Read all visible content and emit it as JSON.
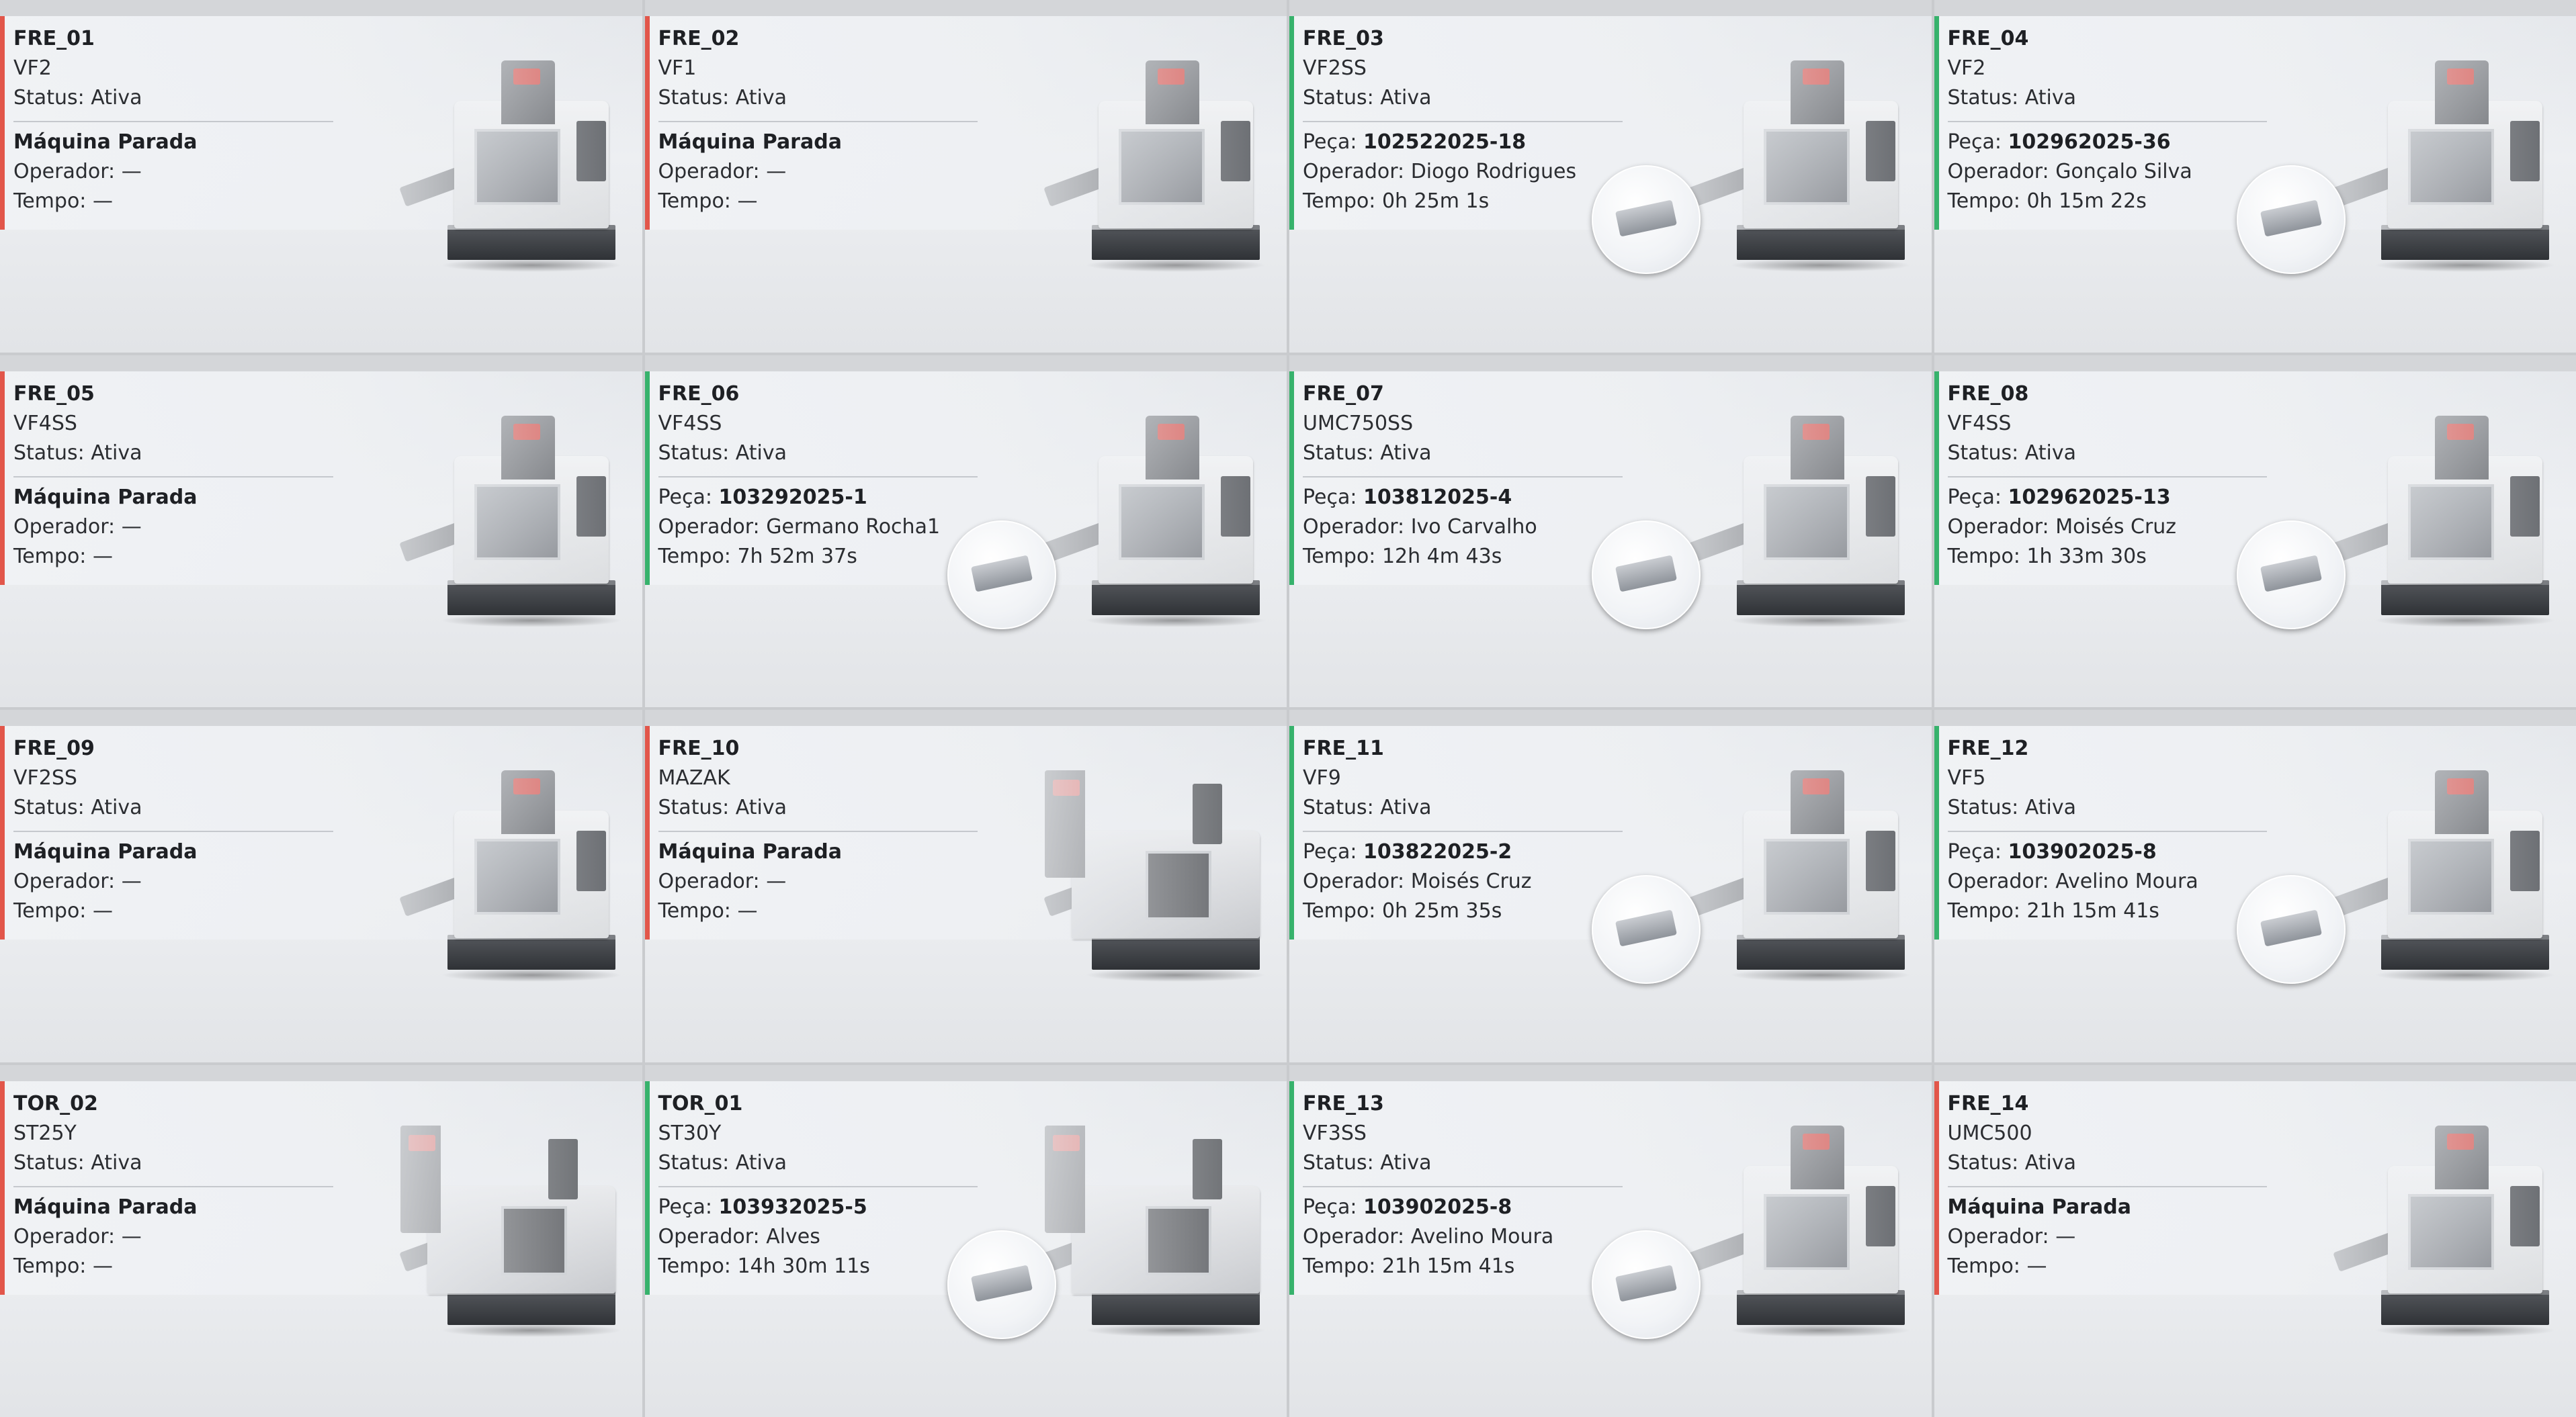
{
  "labels": {
    "status_prefix": "Status: ",
    "part_prefix": "Peça: ",
    "operator_prefix": "Operador: ",
    "time_prefix": "Tempo: ",
    "stopped": "Máquina Parada",
    "none": "—"
  },
  "colors": {
    "stopped_accent": "#e2564a",
    "running_accent": "#37b26c"
  },
  "machines": [
    {
      "code": "FRE_01",
      "model": "VF2",
      "status": "Ativa",
      "state": "stopped",
      "illustration": "vertical-mill",
      "part": null,
      "operator": "—",
      "time": "—"
    },
    {
      "code": "FRE_02",
      "model": "VF1",
      "status": "Ativa",
      "state": "stopped",
      "illustration": "vertical-mill",
      "part": null,
      "operator": "—",
      "time": "—"
    },
    {
      "code": "FRE_03",
      "model": "VF2SS",
      "status": "Ativa",
      "state": "running",
      "illustration": "vertical-mill",
      "part": "102522025-18",
      "operator": "Diogo Rodrigues",
      "time": "0h 25m 1s"
    },
    {
      "code": "FRE_04",
      "model": "VF2",
      "status": "Ativa",
      "state": "running",
      "illustration": "vertical-mill",
      "part": "102962025-36",
      "operator": "Gonçalo Silva",
      "time": "0h 15m 22s"
    },
    {
      "code": "FRE_05",
      "model": "VF4SS",
      "status": "Ativa",
      "state": "stopped",
      "illustration": "vertical-mill",
      "part": null,
      "operator": "—",
      "time": "—"
    },
    {
      "code": "FRE_06",
      "model": "VF4SS",
      "status": "Ativa",
      "state": "running",
      "illustration": "vertical-mill",
      "part": "103292025-1",
      "operator": "Germano Rocha1",
      "time": "7h 52m 37s"
    },
    {
      "code": "FRE_07",
      "model": "UMC750SS",
      "status": "Ativa",
      "state": "running",
      "illustration": "universal-mill",
      "part": "103812025-4",
      "operator": "Ivo Carvalho",
      "time": "12h 4m 43s"
    },
    {
      "code": "FRE_08",
      "model": "VF4SS",
      "status": "Ativa",
      "state": "running",
      "illustration": "vertical-mill",
      "part": "102962025-13",
      "operator": "Moisés Cruz",
      "time": "1h 33m 30s"
    },
    {
      "code": "FRE_09",
      "model": "VF2SS",
      "status": "Ativa",
      "state": "stopped",
      "illustration": "vertical-mill",
      "part": null,
      "operator": "—",
      "time": "—"
    },
    {
      "code": "FRE_10",
      "model": "MAZAK",
      "status": "Ativa",
      "state": "stopped",
      "illustration": "lathe",
      "part": null,
      "operator": "—",
      "time": "—"
    },
    {
      "code": "FRE_11",
      "model": "VF9",
      "status": "Ativa",
      "state": "running",
      "illustration": "vertical-mill",
      "part": "103822025-2",
      "operator": "Moisés Cruz",
      "time": "0h 25m 35s"
    },
    {
      "code": "FRE_12",
      "model": "VF5",
      "status": "Ativa",
      "state": "running",
      "illustration": "vertical-mill",
      "part": "103902025-8",
      "operator": "Avelino Moura",
      "time": "21h 15m 41s"
    },
    {
      "code": "TOR_02",
      "model": "ST25Y",
      "status": "Ativa",
      "state": "stopped",
      "illustration": "lathe",
      "part": null,
      "operator": "—",
      "time": "—"
    },
    {
      "code": "TOR_01",
      "model": "ST30Y",
      "status": "Ativa",
      "state": "running",
      "illustration": "lathe",
      "part": "103932025-5",
      "operator": "Alves",
      "time": "14h 30m 11s"
    },
    {
      "code": "FRE_13",
      "model": "VF3SS",
      "status": "Ativa",
      "state": "running",
      "illustration": "vertical-mill",
      "part": "103902025-8",
      "operator": "Avelino Moura",
      "time": "21h 15m 41s"
    },
    {
      "code": "FRE_14",
      "model": "UMC500",
      "status": "Ativa",
      "state": "stopped",
      "illustration": "universal-mill",
      "part": null,
      "operator": "—",
      "time": "—"
    }
  ]
}
